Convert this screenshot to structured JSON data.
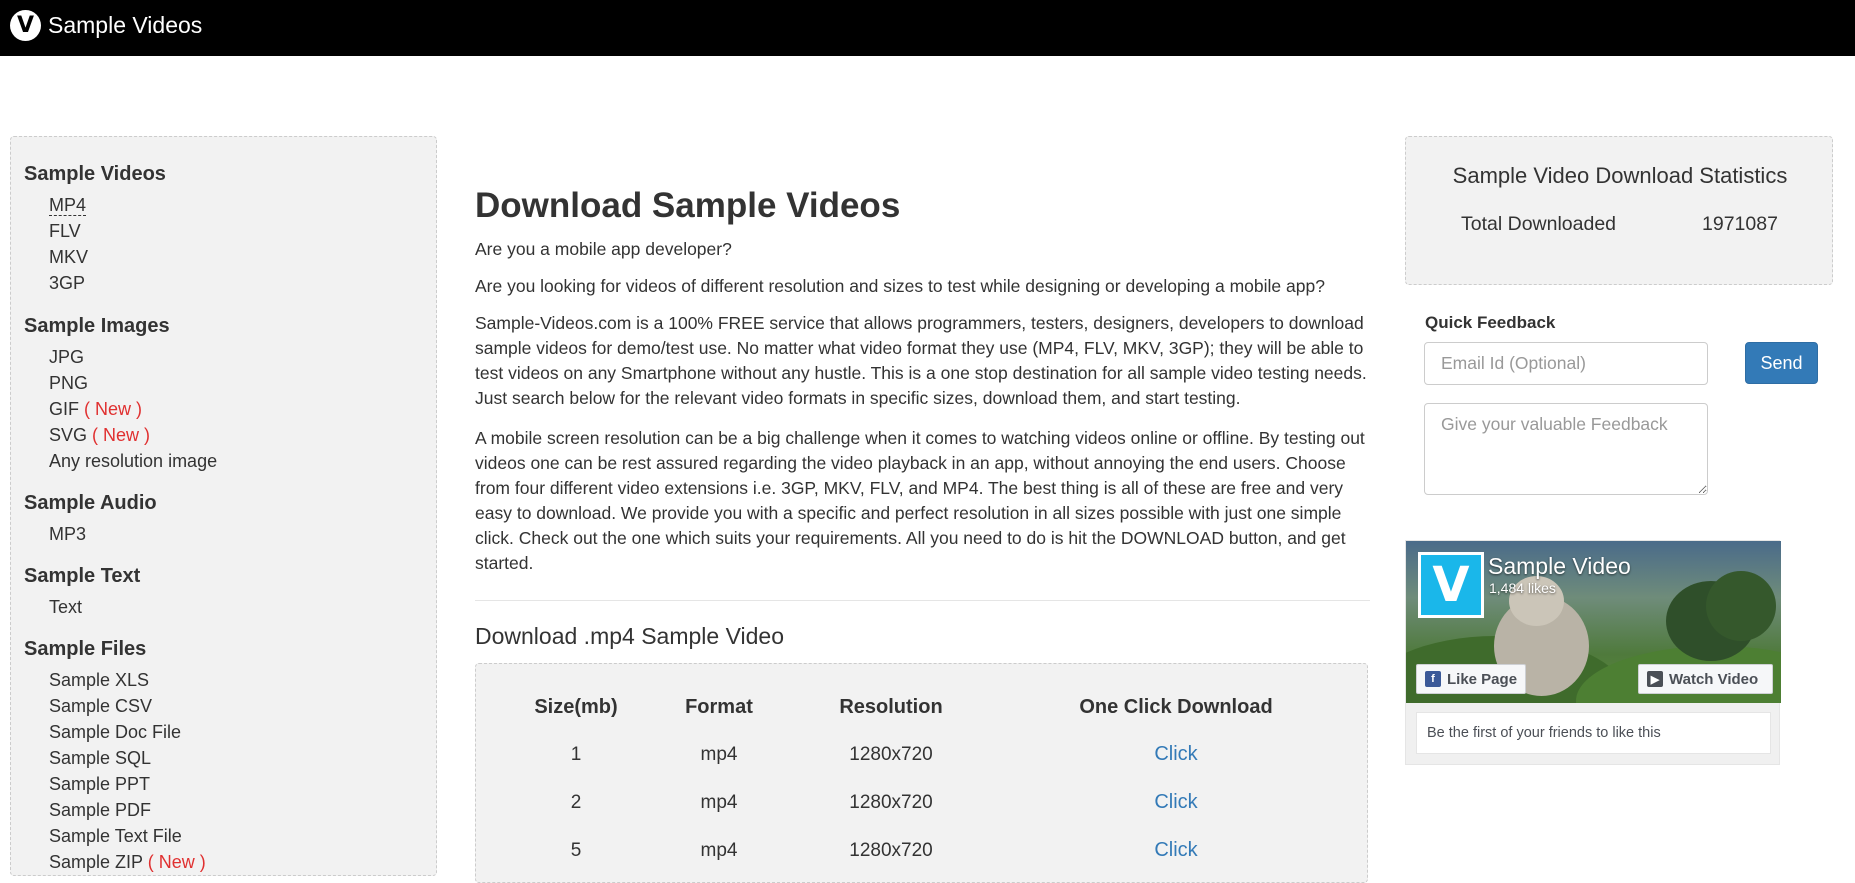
{
  "header": {
    "title": "Sample Videos",
    "logo_letter": "V"
  },
  "sidebar": {
    "sections": [
      {
        "title": "Sample Videos",
        "items": [
          "MP4",
          "FLV",
          "MKV",
          "3GP"
        ]
      },
      {
        "title": "Sample Images",
        "items": [
          "JPG",
          "PNG",
          "GIF",
          "SVG",
          "Any resolution image"
        ]
      },
      {
        "title": "Sample Audio",
        "items": [
          "MP3"
        ]
      },
      {
        "title": "Sample Text",
        "items": [
          "Text"
        ]
      },
      {
        "title": "Sample Files",
        "items": [
          "Sample XLS",
          "Sample CSV",
          "Sample Doc File",
          "Sample SQL",
          "Sample PPT",
          "Sample PDF",
          "Sample Text File",
          "Sample ZIP"
        ]
      }
    ],
    "new_badge": "( New )"
  },
  "main": {
    "title": "Download Sample Videos",
    "p1": "Are you a mobile app developer?",
    "p2": "Are you looking for videos of different resolution and sizes to test while designing or developing a mobile app?",
    "p3": "Sample-Videos.com is a 100% FREE service that allows programmers, testers, designers, developers to download sample videos for demo/test use. No matter what video format they use (MP4, FLV, MKV, 3GP); they will be able to test videos on any Smartphone without any hustle. This is a one stop destination for all sample video testing needs. Just search below for the relevant video formats in specific sizes, download them, and start testing.",
    "p4": "A mobile screen resolution can be a big challenge when it comes to watching videos online or offline. By testing out videos one can be rest assured regarding the video playback in an app, without annoying the end users. Choose from four different video extensions i.e. 3GP, MKV, FLV, and MP4. The best thing is all of these are free and very easy to download. We provide you with a specific and perfect resolution in all sizes possible with just one simple click. Check out the one which suits your requirements. All you need to do is hit the DOWNLOAD button, and get started.",
    "subheading": "Download .mp4 Sample Video",
    "table": {
      "headers": [
        "Size(mb)",
        "Format",
        "Resolution",
        "One Click Download"
      ],
      "rows": [
        [
          "1",
          "mp4",
          "1280x720",
          "Click"
        ],
        [
          "2",
          "mp4",
          "1280x720",
          "Click"
        ],
        [
          "5",
          "mp4",
          "1280x720",
          "Click"
        ]
      ]
    }
  },
  "stats": {
    "title": "Sample Video Download Statistics",
    "label": "Total Downloaded",
    "value": "1971087"
  },
  "feedback": {
    "title": "Quick Feedback",
    "email_placeholder": "Email Id (Optional)",
    "send_label": "Send",
    "feedback_placeholder": "Give your valuable Feedback"
  },
  "facebook": {
    "page_name": "Sample Video",
    "likes": "1,484 likes",
    "like_button": "Like Page",
    "watch_button": "Watch Video",
    "footer": "Be the first of your friends to like this",
    "avatar_letter": "V"
  }
}
